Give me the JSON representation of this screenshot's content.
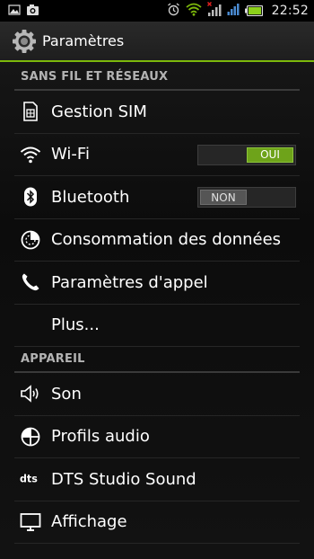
{
  "status_bar": {
    "time": "22:52",
    "icons": [
      "gallery-icon",
      "camera-icon",
      "alarm-icon",
      "wifi-icon",
      "signal-blocked-icon",
      "signal-icon",
      "battery-icon"
    ]
  },
  "action_bar": {
    "title": "Paramètres",
    "icon": "settings-gear-icon"
  },
  "sections": [
    {
      "header": "SANS FIL ET RÉSEAUX",
      "items": [
        {
          "label": "Gestion SIM",
          "icon": "sim-card-icon"
        },
        {
          "label": "Wi-Fi",
          "icon": "wifi-icon",
          "toggle": {
            "state": "on",
            "label": "OUI"
          }
        },
        {
          "label": "Bluetooth",
          "icon": "bluetooth-icon",
          "toggle": {
            "state": "off",
            "label": "NON"
          }
        },
        {
          "label": "Consommation des données",
          "icon": "data-usage-icon"
        },
        {
          "label": "Paramètres d'appel",
          "icon": "phone-icon"
        },
        {
          "label": "Plus...",
          "icon": ""
        }
      ]
    },
    {
      "header": "APPAREIL",
      "items": [
        {
          "label": "Son",
          "icon": "speaker-icon"
        },
        {
          "label": "Profils audio",
          "icon": "audio-profile-icon"
        },
        {
          "label": "DTS Studio Sound",
          "icon": "dts-logo-icon"
        },
        {
          "label": "Affichage",
          "icon": "display-icon"
        }
      ]
    }
  ],
  "colors": {
    "accent": "#7cb80b",
    "toggle_on": "#6ea31a",
    "toggle_off": "#555555",
    "section_header": "#b3b3b3"
  }
}
